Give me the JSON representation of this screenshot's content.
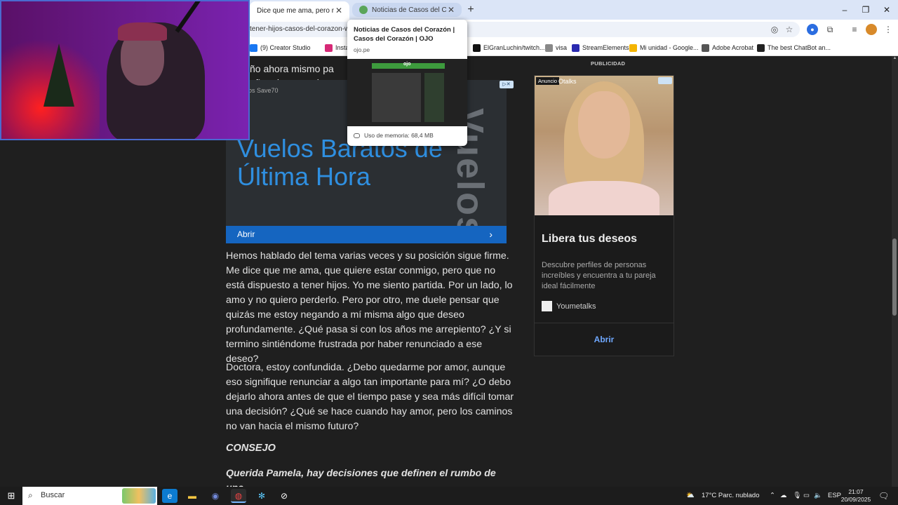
{
  "browser": {
    "tabs": [
      {
        "title": "Dice que me ama, pero no quiere tener hijos",
        "active": true
      },
      {
        "title": "Noticias de Casos del Corazón | OJO",
        "active": false
      }
    ],
    "new_tab_symbol": "+",
    "window_controls": {
      "minimize": "–",
      "restore": "❐",
      "close": "✕"
    },
    "address": "tener-hijos-casos-del-corazon-we",
    "bookmarks": [
      {
        "label": "(9) Creator Studio",
        "icon": "meta-icon"
      },
      {
        "label": "Insta",
        "icon": "instagram-icon"
      },
      {
        "label": "ElGranLuchin/twitch...",
        "icon": "tiktok-icon"
      },
      {
        "label": "visa",
        "icon": "link-icon"
      },
      {
        "label": "StreamElements",
        "icon": "streamelements-icon"
      },
      {
        "label": "Mi unidad - Google...",
        "icon": "drive-icon"
      },
      {
        "label": "Adobe Acrobat",
        "icon": "acrobat-icon"
      },
      {
        "label": "The best ChatBot an...",
        "icon": "chatgpt-icon"
      }
    ]
  },
  "hovercard": {
    "title": "Noticias de Casos del Corazón | Casos del Corazón | OJO",
    "domain": "ojo.pe",
    "thumb_logo": "ojo",
    "memory": "Uso de memoria: 68,4 MB"
  },
  "article": {
    "top_text_line1": "ño ahora mismo pa",
    "top_text_line2": "eño, algo que siempre",
    "ad_small_label": "os Save70",
    "ad_headline": "Vuelos Baratos de Última Hora",
    "ad_vertical": "Vuelos",
    "ad_open": "Abrir",
    "p1": "Hemos hablado del tema varias veces y su posición sigue firme. Me dice que me ama, que quiere estar conmigo, pero que no está dispuesto a tener hijos. Yo me siento partida. Por un lado, lo amo y no quiero perderlo. Pero por otro, me duele pensar que quizás me estoy negando a mí misma algo que deseo profundamente. ¿Qué pasa si con los años me arrepiento? ¿Y si termino sintiéndome frustrada por haber renunciado a ese deseo?",
    "p2": "Doctora, estoy confundida. ¿Debo quedarme por amor, aunque eso signifique renunciar a algo tan importante para mí? ¿O debo dejarlo ahora antes de que el tiempo pase y sea más difícil tomar una decisión? ¿Qué se hace cuando hay amor, pero los caminos no van hacia el mismo futuro?",
    "consejo": "CONSEJO",
    "p3": "Querida Pamela, hay decisiones que definen el rumbo de una"
  },
  "sidebar_ad": {
    "publicidad": "PUBLICIDAD",
    "anuncio": "Anuncio",
    "brand_top": "Otalks",
    "title": "Libera tus deseos",
    "desc": "Descubre perfiles de personas increíbles y encuentra a tu pareja ideal fácilmente",
    "brand": "Youmetalks",
    "cta": "Abrir"
  },
  "taskbar": {
    "search_placeholder": "Buscar",
    "weather": "17°C  Parc. nublado",
    "lang": "ESP",
    "time": "21:07",
    "date": "20/09/2025",
    "apps": [
      "edge-icon",
      "file-explorer-icon",
      "discord-icon",
      "chrome-icon",
      "app-icon",
      "obs-icon"
    ]
  },
  "colors": {
    "ad_accent": "#2f8fe0",
    "ad_button": "#1565c0",
    "cta_link": "#6fa8ff",
    "page_bg": "#1f1f1f"
  }
}
